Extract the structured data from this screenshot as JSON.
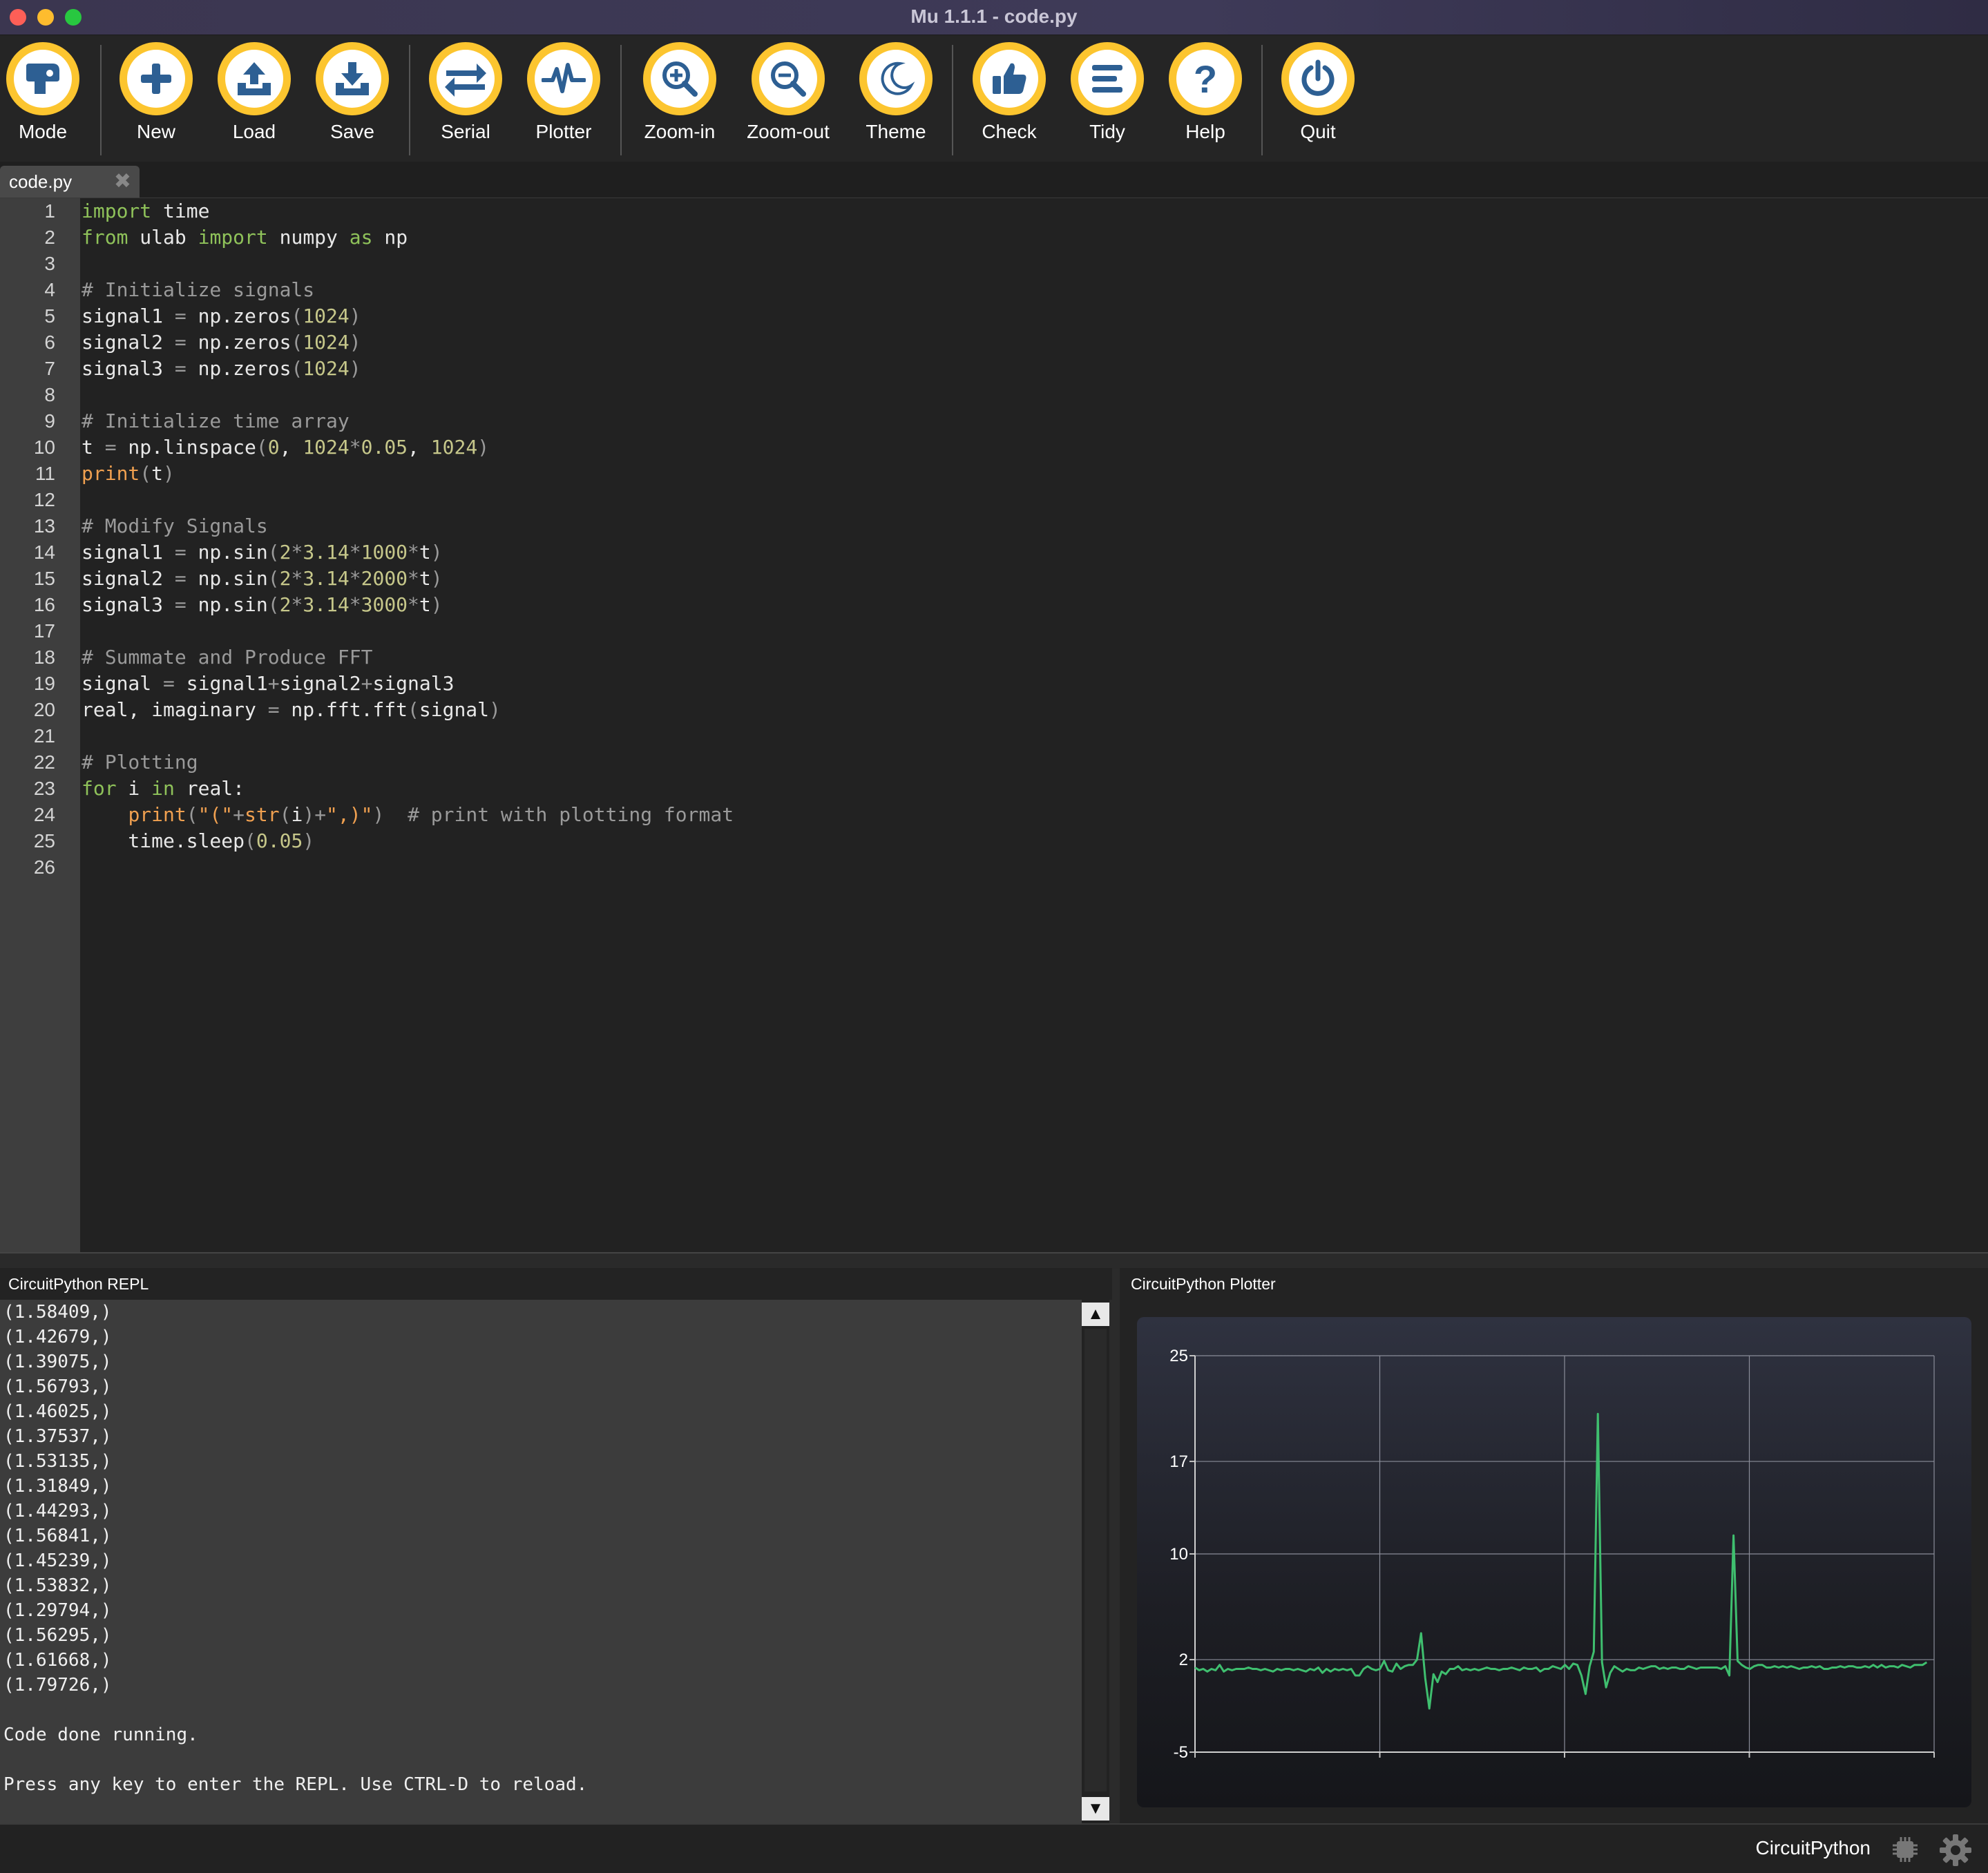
{
  "window": {
    "title": "Mu 1.1.1 - code.py"
  },
  "toolbar": {
    "buttons": [
      {
        "label": "Mode",
        "icon": "mode-icon"
      },
      {
        "label": "New",
        "icon": "plus-icon"
      },
      {
        "label": "Load",
        "icon": "upload-icon"
      },
      {
        "label": "Save",
        "icon": "download-icon"
      },
      {
        "label": "Serial",
        "icon": "swap-arrows-icon"
      },
      {
        "label": "Plotter",
        "icon": "pulse-icon"
      },
      {
        "label": "Zoom-in",
        "icon": "zoom-in-icon"
      },
      {
        "label": "Zoom-out",
        "icon": "zoom-out-icon"
      },
      {
        "label": "Theme",
        "icon": "moon-icon"
      },
      {
        "label": "Check",
        "icon": "thumbs-up-icon"
      },
      {
        "label": "Tidy",
        "icon": "lines-icon"
      },
      {
        "label": "Help",
        "icon": "question-icon"
      },
      {
        "label": "Quit",
        "icon": "power-icon"
      }
    ],
    "icon_color": "#2d5f93",
    "ring_color": "#fcc52f"
  },
  "tabs": [
    {
      "label": "code.py",
      "close": "✖"
    }
  ],
  "editor": {
    "line_numbers": [
      "1",
      "2",
      "3",
      "4",
      "5",
      "6",
      "7",
      "8",
      "9",
      "10",
      "11",
      "12",
      "13",
      "14",
      "15",
      "16",
      "17",
      "18",
      "19",
      "20",
      "21",
      "22",
      "23",
      "24",
      "25",
      "26"
    ],
    "lines": [
      "import time",
      "from ulab import numpy as np",
      "",
      "# Initialize signals",
      "signal1 = np.zeros(1024)",
      "signal2 = np.zeros(1024)",
      "signal3 = np.zeros(1024)",
      "",
      "# Initialize time array",
      "t = np.linspace(0, 1024*0.05, 1024)",
      "print(t)",
      "",
      "# Modify Signals",
      "signal1 = np.sin(2*3.14*1000*t)",
      "signal2 = np.sin(2*3.14*2000*t)",
      "signal3 = np.sin(2*3.14*3000*t)",
      "",
      "# Summate and Produce FFT",
      "signal = signal1+signal2+signal3",
      "real, imaginary = np.fft.fft(signal)",
      "",
      "# Plotting",
      "for i in real:",
      "    print(\"(\"+str(i)+\",)\")  # print with plotting format",
      "    time.sleep(0.05)",
      ""
    ]
  },
  "repl": {
    "title": "CircuitPython REPL",
    "lines": [
      "(1.58409,)",
      "(1.42679,)",
      "(1.39075,)",
      "(1.56793,)",
      "(1.46025,)",
      "(1.37537,)",
      "(1.53135,)",
      "(1.31849,)",
      "(1.44293,)",
      "(1.56841,)",
      "(1.45239,)",
      "(1.53832,)",
      "(1.29794,)",
      "(1.56295,)",
      "(1.61668,)",
      "(1.79726,)",
      "",
      "Code done running.",
      "",
      "Press any key to enter the REPL. Use CTRL-D to reload."
    ],
    "scroll_up": "▲",
    "scroll_down": "▼"
  },
  "plotter": {
    "title": "CircuitPython Plotter"
  },
  "chart_data": {
    "type": "line",
    "ylim": [
      -5,
      25
    ],
    "y_ticks": [
      "25",
      "17",
      "10",
      "2",
      "-5"
    ],
    "y_tick_values": [
      25,
      17,
      10,
      2,
      -5
    ],
    "grid": true,
    "line_color": "#3fbf6f",
    "series": [
      {
        "values": [
          1.4,
          1.2,
          1.3,
          1.1,
          1.3,
          1.2,
          1.6,
          1.1,
          1.3,
          1.2,
          1.3,
          1.3,
          1.3,
          1.4,
          1.3,
          1.3,
          1.2,
          1.3,
          1.2,
          1.1,
          1.3,
          1.2,
          1.3,
          1.3,
          1.2,
          1.3,
          1.2,
          1.1,
          1.3,
          1.2,
          1.4,
          1.0,
          1.3,
          1.1,
          1.3,
          1.2,
          1.3,
          1.2,
          1.3,
          0.8,
          0.8,
          1.3,
          1.5,
          1.3,
          1.2,
          1.3,
          1.9,
          1.2,
          1.1,
          1.7,
          1.3,
          1.5,
          1.6,
          1.6,
          2.0,
          4.0,
          0.6,
          -1.7,
          0.9,
          0.3,
          1.1,
          0.9,
          1.3,
          1.3,
          1.5,
          1.2,
          1.3,
          1.2,
          1.3,
          1.2,
          1.3,
          1.4,
          1.3,
          1.3,
          1.2,
          1.3,
          1.3,
          1.4,
          1.3,
          1.2,
          1.4,
          1.3,
          1.3,
          1.4,
          1.1,
          1.3,
          1.3,
          1.5,
          1.4,
          1.3,
          1.6,
          1.3,
          1.7,
          1.6,
          0.8,
          -0.6,
          1.5,
          2.6,
          20.6,
          1.8,
          -0.1,
          1.0,
          1.5,
          1.3,
          1.1,
          1.3,
          1.2,
          1.2,
          1.4,
          1.3,
          1.4,
          1.5,
          1.5,
          1.3,
          1.4,
          1.3,
          1.4,
          1.4,
          1.3,
          1.3,
          1.5,
          1.4,
          1.3,
          1.4,
          1.4,
          1.4,
          1.4,
          1.4,
          1.3,
          1.5,
          0.8,
          11.4,
          1.9,
          1.6,
          1.4,
          1.3,
          1.5,
          1.6,
          1.6,
          1.4,
          1.4,
          1.5,
          1.4,
          1.5,
          1.4,
          1.5,
          1.4,
          1.3,
          1.4,
          1.4,
          1.5,
          1.4,
          1.5,
          1.3,
          1.3,
          1.4,
          1.4,
          1.5,
          1.4,
          1.5,
          1.5,
          1.4,
          1.4,
          1.5,
          1.4,
          1.6,
          1.4,
          1.6,
          1.4,
          1.5,
          1.5,
          1.4,
          1.6,
          1.5,
          1.4,
          1.6,
          1.6,
          1.6,
          1.8
        ]
      }
    ]
  },
  "statusbar": {
    "mode": "CircuitPython"
  }
}
